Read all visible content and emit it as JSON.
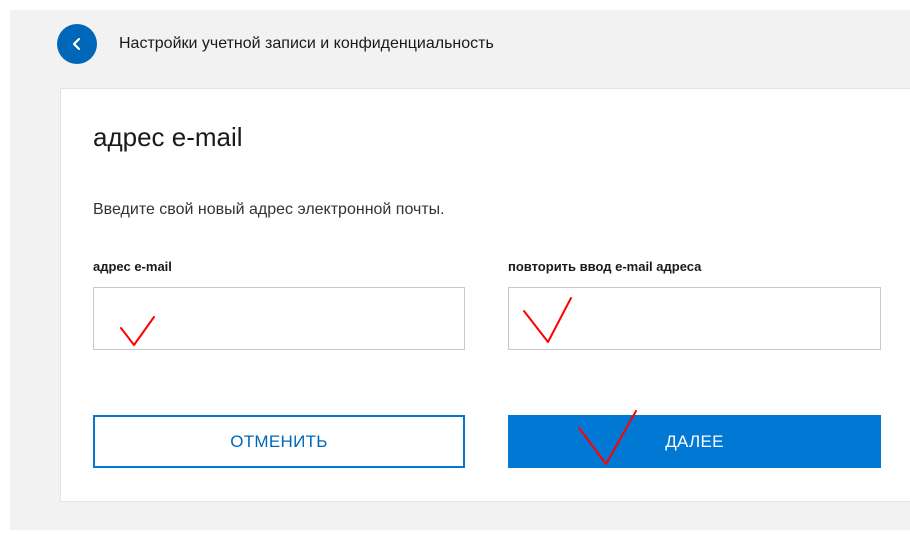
{
  "header": {
    "title": "Настройки учетной записи и конфиденциальность",
    "back_icon": "chevron-left-icon"
  },
  "card": {
    "title": "адрес e-mail",
    "description": "Введите свой новый адрес электронной почты."
  },
  "form": {
    "email": {
      "label": "адрес e-mail",
      "value": ""
    },
    "email_confirm": {
      "label": "повторить ввод e-mail адреса",
      "value": ""
    }
  },
  "buttons": {
    "cancel_label": "ОТМЕНИТЬ",
    "next_label": "ДАЛЕЕ"
  },
  "colors": {
    "accent": "#0078d4",
    "annotation": "#ff0000"
  }
}
